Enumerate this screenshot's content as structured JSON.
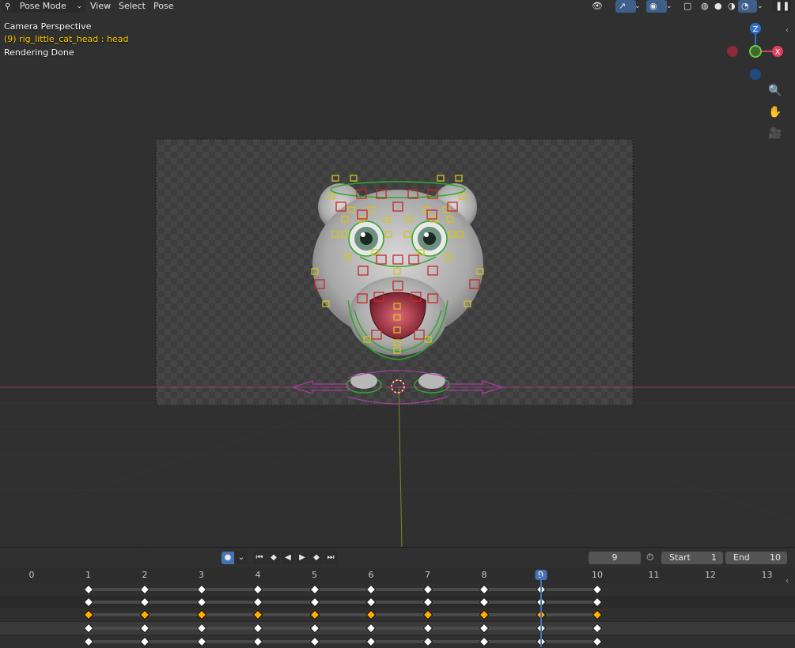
{
  "header": {
    "mode_label": "Pose Mode",
    "menu": [
      "View",
      "Select",
      "Pose"
    ]
  },
  "overlay": {
    "camera": "Camera Perspective",
    "object": "(9) rig_little_cat_head : head",
    "status": "Rendering Done"
  },
  "gizmo": {
    "z": "Z",
    "x": "X"
  },
  "timeline": {
    "current_frame": "9",
    "start_label": "Start",
    "start_value": "1",
    "end_label": "End",
    "end_value": "10",
    "frames": [
      "0",
      "1",
      "2",
      "3",
      "4",
      "5",
      "6",
      "7",
      "8",
      "9",
      "10",
      "11",
      "12",
      "13"
    ],
    "keyframe_frames": [
      1,
      2,
      3,
      4,
      5,
      6,
      7,
      8,
      9,
      10
    ]
  },
  "colors": {
    "accent": "#4772b3",
    "keyframe_selected": "#ffb000",
    "keyframe": "#ffffff",
    "bone_yellow": "#d4c41e",
    "bone_red": "#c92626",
    "bone_green": "#2fa62f",
    "bone_magenta": "#a63ca6"
  }
}
